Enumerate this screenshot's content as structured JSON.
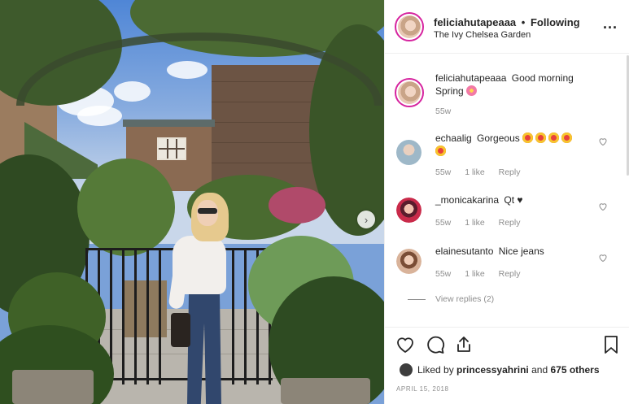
{
  "post": {
    "username": "feliciahutapeaaa",
    "dot": "•",
    "follow_status": "Following",
    "location": "The Ivy Chelsea Garden"
  },
  "caption": {
    "username": "feliciahutapeaaa",
    "text": "Good morning Spring",
    "age": "55w"
  },
  "comments": [
    {
      "username": "echaalig",
      "text": "Gorgeous",
      "age": "55w",
      "likes": "1 like",
      "reply": "Reply",
      "emojis": [
        "heart-eyes-emoji",
        "heart-eyes-emoji",
        "heart-eyes-emoji",
        "heart-eyes-emoji",
        "heart-eyes-emoji"
      ]
    },
    {
      "username": "_monicakarina",
      "text": "Qt ♥",
      "age": "55w",
      "likes": "1 like",
      "reply": "Reply"
    },
    {
      "username": "elainesutanto",
      "text": "Nice jeans",
      "age": "55w",
      "likes": "1 like",
      "reply": "Reply"
    }
  ],
  "view_replies": "View replies (2)",
  "likes": {
    "prefix": "Liked by",
    "user": "princessyahrini",
    "and": "and",
    "others": "675 others"
  },
  "date": "APRIL 15, 2018",
  "colors": {
    "story_ring": "#d6249f",
    "text": "#262626",
    "muted": "#8e8e8e",
    "border": "#efefef"
  },
  "icons": [
    "more-options-icon",
    "like-heart-icon",
    "comment-icon",
    "share-icon",
    "save-bookmark-icon",
    "next-slide-chevron-icon",
    "flower-emoji"
  ]
}
